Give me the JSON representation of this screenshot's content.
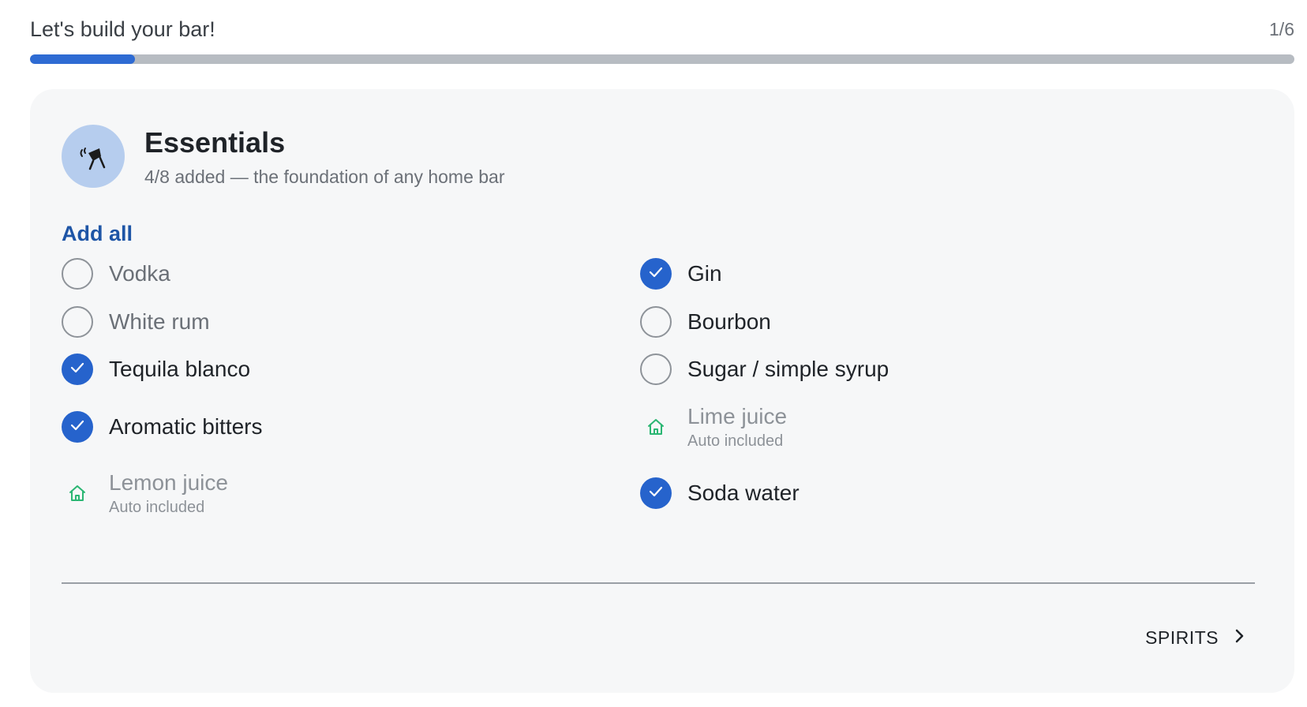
{
  "header": {
    "title": "Let's build your bar!",
    "step": "1/6",
    "progress_fraction": 0.083
  },
  "category": {
    "icon": "cocktail-shaker-icon",
    "title": "Essentials",
    "subtitle": "4/8 added — the foundation of any home bar",
    "add_all_label": "Add all"
  },
  "items": [
    {
      "label": "Vodka",
      "state": "unchecked"
    },
    {
      "label": "Gin",
      "state": "checked"
    },
    {
      "label": "White rum",
      "state": "unchecked"
    },
    {
      "label": "Bourbon",
      "state": "unchecked"
    },
    {
      "label": "Tequila blanco",
      "state": "checked"
    },
    {
      "label": "Sugar / simple syrup",
      "state": "unchecked"
    },
    {
      "label": "Aromatic bitters",
      "state": "checked"
    },
    {
      "label": "Lime juice",
      "state": "auto",
      "note": "Auto included"
    },
    {
      "label": "Lemon juice",
      "state": "auto",
      "note": "Auto included"
    },
    {
      "label": "Soda water",
      "state": "checked"
    }
  ],
  "footer": {
    "next_label": "SPIRITS",
    "next_icon": "chevron-right-icon"
  },
  "colors": {
    "accent": "#2663cc",
    "home_icon": "#2bb673",
    "link": "#1e55a6"
  }
}
